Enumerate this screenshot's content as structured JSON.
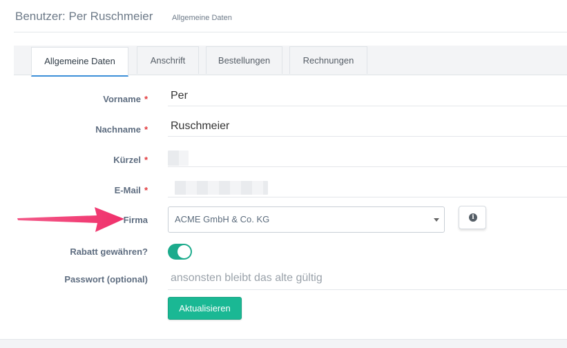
{
  "header": {
    "title": "Benutzer: Per Ruschmeier",
    "subtitle": "Allgemeine Daten"
  },
  "tabs": [
    {
      "label": "Allgemeine Daten",
      "active": true
    },
    {
      "label": "Anschrift",
      "active": false
    },
    {
      "label": "Bestellungen",
      "active": false
    },
    {
      "label": "Rechnungen",
      "active": false
    }
  ],
  "form": {
    "vorname": {
      "label": "Vorname",
      "required_mark": "*",
      "value": "Per"
    },
    "nachname": {
      "label": "Nachname",
      "required_mark": "*",
      "value": "Ruschmeier"
    },
    "kuerzel": {
      "label": "Kürzel",
      "required_mark": "*"
    },
    "email": {
      "label": "E-Mail",
      "required_mark": "*"
    },
    "firma": {
      "label": "Firma",
      "value": "ACME GmbH & Co. KG",
      "info_icon": "info-icon"
    },
    "rabatt": {
      "label": "Rabatt gewähren?",
      "enabled": true
    },
    "passwort": {
      "label": "Passwort (optional)",
      "placeholder": "ansonsten bleibt das alte gültig"
    },
    "submit_label": "Aktualisieren"
  },
  "colors": {
    "accent": "#1ab894",
    "arrow": "#f0306b",
    "required": "#e1373a"
  }
}
